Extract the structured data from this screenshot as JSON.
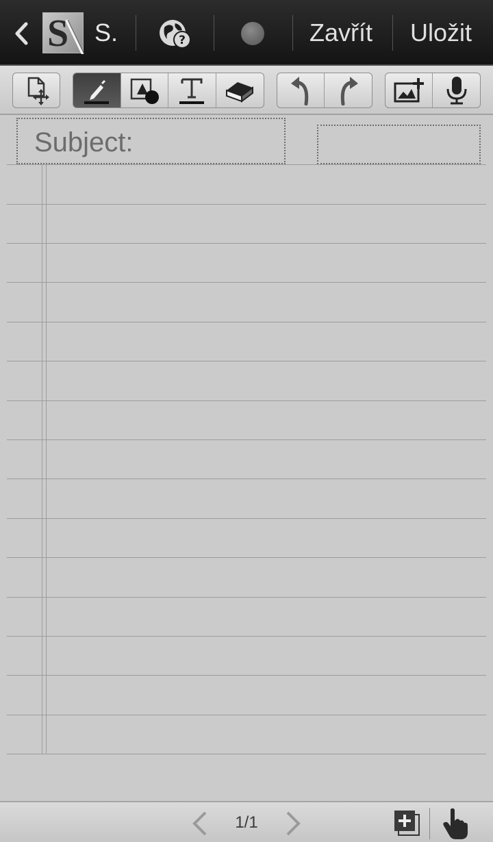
{
  "action_bar": {
    "app_logo_letter": "S",
    "app_name": "S.",
    "close_label": "Zavřít",
    "save_label": "Uložit",
    "icons": [
      "back-arrow-icon",
      "globe-help-icon",
      "record-dot-icon"
    ]
  },
  "toolbar": {
    "groups": [
      {
        "items": [
          "page-move-icon"
        ]
      },
      {
        "items": [
          "pen-icon",
          "shape-icon",
          "text-icon",
          "eraser-icon"
        ],
        "active": "pen-icon"
      },
      {
        "items": [
          "undo-icon",
          "redo-icon"
        ]
      },
      {
        "items": [
          "insert-image-icon",
          "microphone-icon"
        ]
      }
    ]
  },
  "note": {
    "subject_label": "Subject:",
    "date_value": ""
  },
  "bottom_bar": {
    "page_indicator": "1/1",
    "icons": [
      "prev-page-icon",
      "next-page-icon",
      "add-page-icon",
      "hand-pointer-icon"
    ]
  },
  "colors": {
    "action_bar_bg": "#1c1c1c",
    "paper_bg": "#cbcbcb",
    "rule_line": "#9c9c9c",
    "active_tool_bg": "#4a4a4a"
  }
}
